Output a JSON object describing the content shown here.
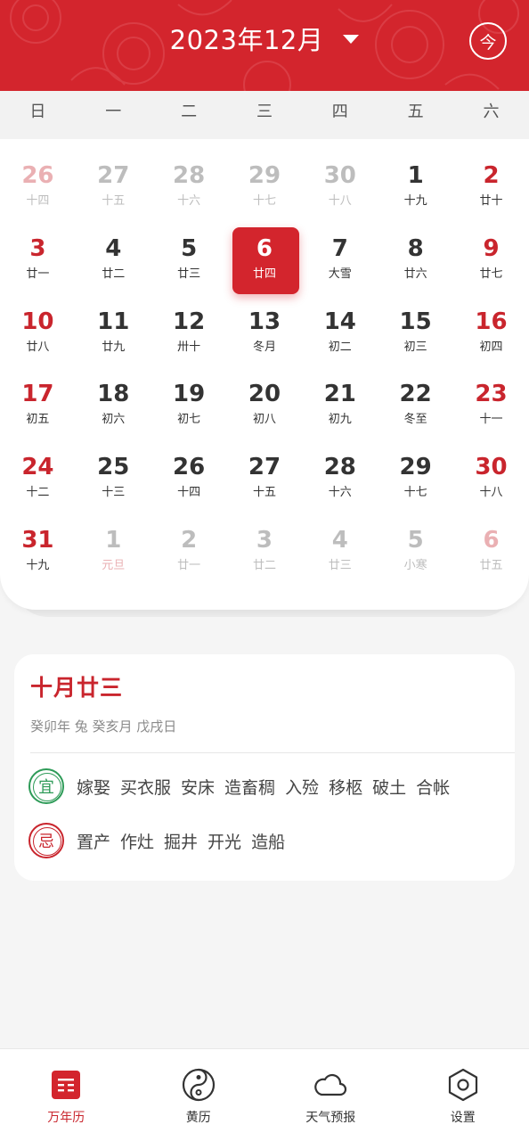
{
  "header": {
    "title": "2023年12月",
    "today_label": "今"
  },
  "weekdays": [
    "日",
    "一",
    "二",
    "三",
    "四",
    "五",
    "六"
  ],
  "calendar": {
    "selected_day": "6",
    "days": [
      {
        "num": "26",
        "lunar": "十四",
        "other": true,
        "weekend": true
      },
      {
        "num": "27",
        "lunar": "十五",
        "other": true,
        "weekend": false
      },
      {
        "num": "28",
        "lunar": "十六",
        "other": true,
        "weekend": false
      },
      {
        "num": "29",
        "lunar": "十七",
        "other": true,
        "weekend": false
      },
      {
        "num": "30",
        "lunar": "十八",
        "other": true,
        "weekend": false
      },
      {
        "num": "1",
        "lunar": "十九",
        "other": false,
        "weekend": false
      },
      {
        "num": "2",
        "lunar": "廿十",
        "other": false,
        "weekend": true
      },
      {
        "num": "3",
        "lunar": "廿一",
        "other": false,
        "weekend": true
      },
      {
        "num": "4",
        "lunar": "廿二",
        "other": false,
        "weekend": false
      },
      {
        "num": "5",
        "lunar": "廿三",
        "other": false,
        "weekend": false
      },
      {
        "num": "6",
        "lunar": "廿四",
        "other": false,
        "weekend": false,
        "selected": true
      },
      {
        "num": "7",
        "lunar": "大雪",
        "other": false,
        "weekend": false
      },
      {
        "num": "8",
        "lunar": "廿六",
        "other": false,
        "weekend": false
      },
      {
        "num": "9",
        "lunar": "廿七",
        "other": false,
        "weekend": true
      },
      {
        "num": "10",
        "lunar": "廿八",
        "other": false,
        "weekend": true
      },
      {
        "num": "11",
        "lunar": "廿九",
        "other": false,
        "weekend": false
      },
      {
        "num": "12",
        "lunar": "卅十",
        "other": false,
        "weekend": false
      },
      {
        "num": "13",
        "lunar": "冬月",
        "other": false,
        "weekend": false
      },
      {
        "num": "14",
        "lunar": "初二",
        "other": false,
        "weekend": false
      },
      {
        "num": "15",
        "lunar": "初三",
        "other": false,
        "weekend": false
      },
      {
        "num": "16",
        "lunar": "初四",
        "other": false,
        "weekend": true
      },
      {
        "num": "17",
        "lunar": "初五",
        "other": false,
        "weekend": true
      },
      {
        "num": "18",
        "lunar": "初六",
        "other": false,
        "weekend": false
      },
      {
        "num": "19",
        "lunar": "初七",
        "other": false,
        "weekend": false
      },
      {
        "num": "20",
        "lunar": "初八",
        "other": false,
        "weekend": false
      },
      {
        "num": "21",
        "lunar": "初九",
        "other": false,
        "weekend": false
      },
      {
        "num": "22",
        "lunar": "冬至",
        "other": false,
        "weekend": false
      },
      {
        "num": "23",
        "lunar": "十一",
        "other": false,
        "weekend": true
      },
      {
        "num": "24",
        "lunar": "十二",
        "other": false,
        "weekend": true
      },
      {
        "num": "25",
        "lunar": "十三",
        "other": false,
        "weekend": false
      },
      {
        "num": "26",
        "lunar": "十四",
        "other": false,
        "weekend": false
      },
      {
        "num": "27",
        "lunar": "十五",
        "other": false,
        "weekend": false
      },
      {
        "num": "28",
        "lunar": "十六",
        "other": false,
        "weekend": false
      },
      {
        "num": "29",
        "lunar": "十七",
        "other": false,
        "weekend": false
      },
      {
        "num": "30",
        "lunar": "十八",
        "other": false,
        "weekend": true
      },
      {
        "num": "31",
        "lunar": "十九",
        "other": false,
        "weekend": true
      },
      {
        "num": "1",
        "lunar": "元旦",
        "other": true,
        "weekend": false,
        "holiday": true
      },
      {
        "num": "2",
        "lunar": "廿一",
        "other": true,
        "weekend": false
      },
      {
        "num": "3",
        "lunar": "廿二",
        "other": true,
        "weekend": false
      },
      {
        "num": "4",
        "lunar": "廿三",
        "other": true,
        "weekend": false
      },
      {
        "num": "5",
        "lunar": "小寒",
        "other": true,
        "weekend": false
      },
      {
        "num": "6",
        "lunar": "廿五",
        "other": true,
        "weekend": true
      }
    ]
  },
  "almanac": {
    "lunar_date": "十月廿三",
    "ganzhi": "癸卯年 兔 癸亥月 戊戌日",
    "yi_label": "宜",
    "ji_label": "忌",
    "yi_items": [
      "嫁娶",
      "买衣服",
      "安床",
      "造畜稠",
      "入殓",
      "移柩",
      "破土",
      "合帐"
    ],
    "ji_items": [
      "置产",
      "作灶",
      "掘井",
      "开光",
      "造船"
    ]
  },
  "nav": {
    "tabs": [
      {
        "label": "万年历",
        "icon": "calendar-icon",
        "active": true
      },
      {
        "label": "黄历",
        "icon": "yin-yang-icon",
        "active": false
      },
      {
        "label": "天气预报",
        "icon": "cloud-icon",
        "active": false
      },
      {
        "label": "设置",
        "icon": "settings-icon",
        "active": false
      }
    ]
  },
  "colors": {
    "brand_red": "#d3252d",
    "yi_green": "#2e9b58"
  }
}
